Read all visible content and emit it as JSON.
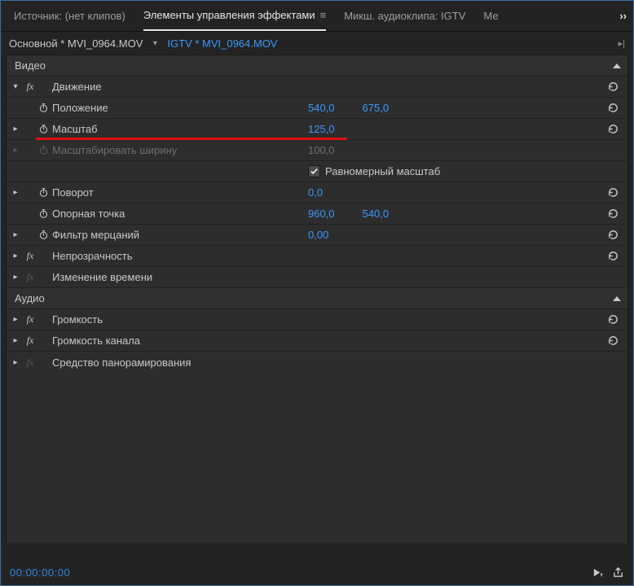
{
  "tabs": {
    "source": "Источник: (нет клипов)",
    "effects": "Элементы управления эффектами",
    "mixer": "Микш. аудиоклипа: IGTV",
    "meta": "Ме"
  },
  "breadcrumb": {
    "primary": "Основной * MVI_0964.MOV",
    "secondary": "IGTV * MVI_0964.MOV"
  },
  "sections": {
    "video": "Видео",
    "audio": "Аудио"
  },
  "effects": {
    "motion": "Движение",
    "opacity": "Непрозрачность",
    "timeRemap": "Изменение времени",
    "volume": "Громкость",
    "channelVolume": "Громкость канала",
    "panner": "Средство панорамирования"
  },
  "props": {
    "position": {
      "label": "Положение",
      "x": "540,0",
      "y": "675,0"
    },
    "scale": {
      "label": "Масштаб",
      "v": "125,0"
    },
    "scaleWidth": {
      "label": "Масштабировать ширину",
      "v": "100,0"
    },
    "uniform": {
      "label": "Равномерный масштаб"
    },
    "rotation": {
      "label": "Поворот",
      "v": "0,0"
    },
    "anchor": {
      "label": "Опорная точка",
      "x": "960,0",
      "y": "540,0"
    },
    "flicker": {
      "label": "Фильтр мерцаний",
      "v": "0,00"
    }
  },
  "timecode": "00:00:00:00"
}
